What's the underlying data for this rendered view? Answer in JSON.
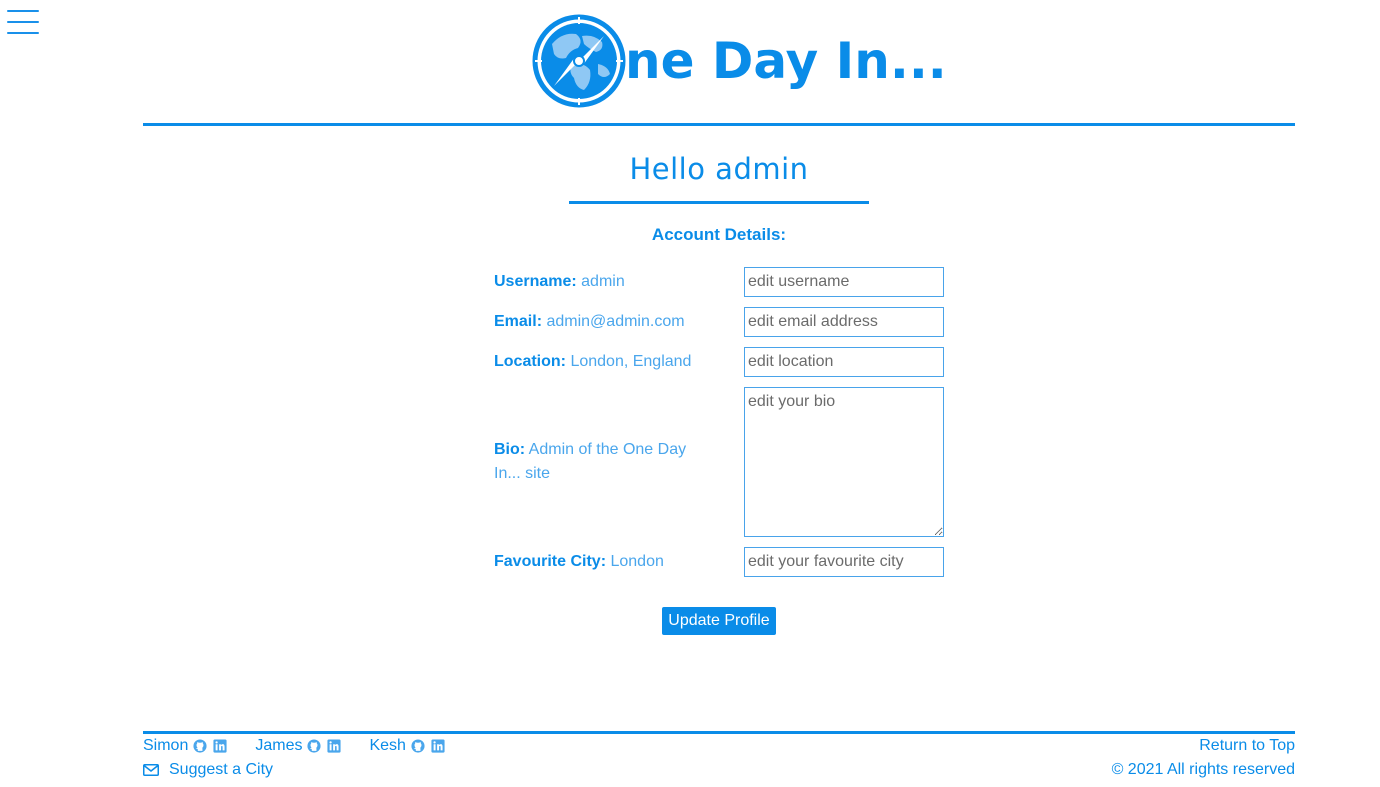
{
  "brand": {
    "logo_text": "ne Day In...",
    "accent_color": "#0a8ce8"
  },
  "nav": {
    "menu_icon": "hamburger-menu-icon"
  },
  "profile": {
    "greeting": "Hello admin",
    "section_title": "Account Details:",
    "fields": {
      "username": {
        "label": "Username:",
        "value": "admin",
        "placeholder": "edit username"
      },
      "email": {
        "label": "Email:",
        "value": "admin@admin.com",
        "placeholder": "edit email address"
      },
      "location": {
        "label": "Location:",
        "value": "London, England",
        "placeholder": "edit location"
      },
      "bio": {
        "label": "Bio:",
        "value": "Admin of the One Day In... site",
        "placeholder": "edit your bio"
      },
      "favourite_city": {
        "label": "Favourite City:",
        "value": "London",
        "placeholder": "edit your favourite city"
      }
    },
    "submit_label": "Update Profile"
  },
  "footer": {
    "credits": [
      {
        "name": "Simon",
        "icons": [
          "github-icon",
          "linkedin-icon"
        ]
      },
      {
        "name": "James",
        "icons": [
          "github-icon",
          "linkedin-icon"
        ]
      },
      {
        "name": "Kesh",
        "icons": [
          "github-icon",
          "linkedin-icon"
        ]
      }
    ],
    "suggest_label": "Suggest a City",
    "suggest_icon": "envelope-icon",
    "return_top_label": "Return to Top",
    "copyright": "© 2021 All rights reserved"
  }
}
